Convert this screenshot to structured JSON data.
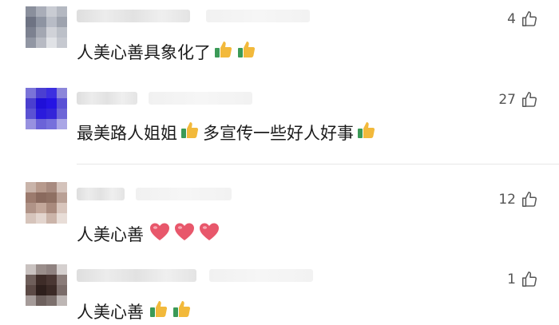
{
  "comments": [
    {
      "likes": "4",
      "segments": [
        {
          "text": "人美心善具象化了"
        }
      ],
      "trailing_emoji": [
        "thumbs-up",
        "thumbs-up"
      ]
    },
    {
      "likes": "27",
      "segments": [
        {
          "text": "最美路人姐姐"
        },
        {
          "text": "多宣传一些好人好事"
        }
      ]
    },
    {
      "likes": "12",
      "segments": [
        {
          "text": "人美心善"
        }
      ],
      "trailing_emoji": [
        "heart",
        "heart",
        "heart"
      ]
    },
    {
      "likes": "1",
      "segments": [
        {
          "text": "人美心善"
        }
      ],
      "trailing_emoji": [
        "thumbs-up",
        "thumbs-up"
      ]
    }
  ],
  "icons": {
    "like": "thumbs-up-outline-icon",
    "emoji_thumbs": "thumbs-up-emoji-icon",
    "emoji_heart": "heart-emoji-icon"
  },
  "colors": {
    "text": "#1b1b1b",
    "meta": "#555555",
    "divider": "#e8e8e8",
    "heart": "#e8576b",
    "thumb": "#f2b93b"
  }
}
